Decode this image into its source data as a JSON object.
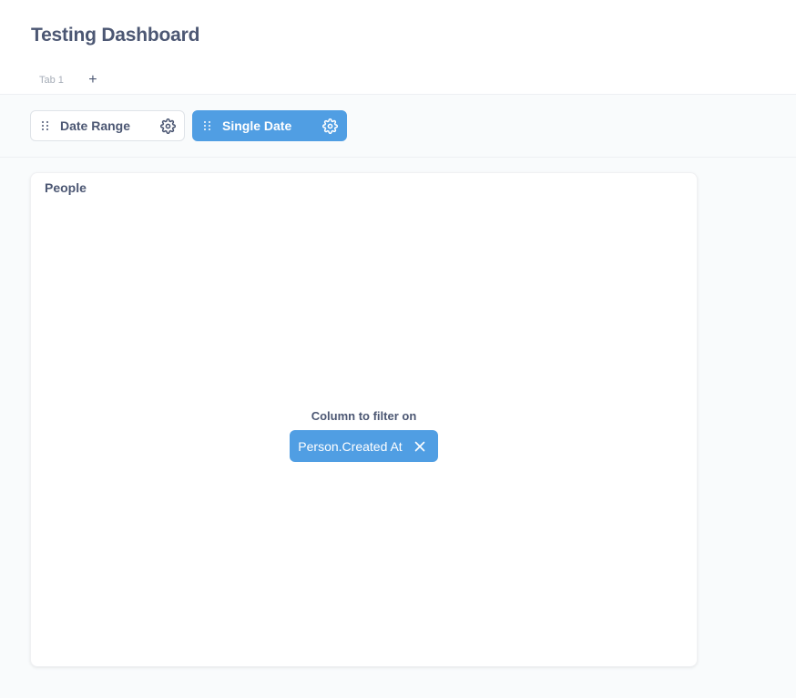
{
  "dashboard": {
    "title": "Testing Dashboard",
    "tabs": [
      {
        "label": "Tab 1"
      }
    ],
    "add_tab_symbol": "+"
  },
  "parameters": [
    {
      "label": "Date Range",
      "state": "default",
      "drag_icon": "grip-icon",
      "settings_icon": "gear-icon"
    },
    {
      "label": "Single Date",
      "state": "selected",
      "drag_icon": "grip-icon",
      "settings_icon": "gear-icon"
    }
  ],
  "card": {
    "title": "People",
    "mapping_label": "Column to filter on",
    "mapped_column": "Person.Created At",
    "remove_icon": "close-icon"
  },
  "colors": {
    "brand": "#509ee3",
    "text_dark": "#4c5773",
    "text_light": "#a6adb8",
    "background": "#f9fbfc"
  }
}
